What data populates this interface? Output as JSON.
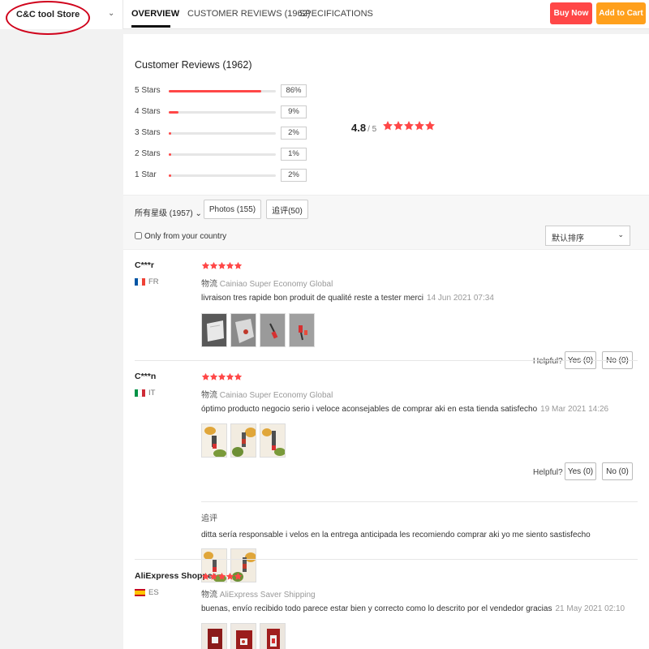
{
  "store": {
    "name": "C&C tool Store"
  },
  "tabs": [
    {
      "label": "OVERVIEW"
    },
    {
      "label": "CUSTOMER REVIEWS (1962)"
    },
    {
      "label": "SPECIFICATIONS"
    }
  ],
  "actions": {
    "buy_now": "Buy Now",
    "add_to_cart": "Add to Cart"
  },
  "colors": {
    "accent": "#ff4747",
    "cart": "#ffa01c",
    "star": "#ff4747"
  },
  "summary": {
    "title": "Customer Reviews (1962)",
    "average": "4.8",
    "out_of": "/ 5",
    "average_value": 4.8,
    "distribution": [
      {
        "label": "5 Stars",
        "pct": "86%",
        "value": 86
      },
      {
        "label": "4 Stars",
        "pct": "9%",
        "value": 9
      },
      {
        "label": "3 Stars",
        "pct": "2%",
        "value": 2
      },
      {
        "label": "2 Stars",
        "pct": "1%",
        "value": 1
      },
      {
        "label": "1 Star",
        "pct": "2%",
        "value": 2
      }
    ]
  },
  "filters": {
    "all_ratings": "所有星级 (1957)",
    "photos": "Photos (155)",
    "additional": "追评(50)",
    "only_country": "Only from your country",
    "sort": "默认排序"
  },
  "helpful": {
    "label": "Helpful?",
    "yes": "Yes (0)",
    "no": "No (0)"
  },
  "reviews": [
    {
      "user": "C***r",
      "country": "FR",
      "rating": 5,
      "shipping_prefix": "物流",
      "shipping": "Cainiao Super Economy Global",
      "text": "livraison tres rapide bon produit de qualité reste a tester merci",
      "date": "14 Jun 2021 07:34"
    },
    {
      "user": "C***n",
      "country": "IT",
      "rating": 5,
      "shipping_prefix": "物流",
      "shipping": "Cainiao Super Economy Global",
      "text": "óptimo producto negocio serio i veloce aconsejables de comprar aki en esta tienda satisfecho",
      "date": "19 Mar 2021 14:26",
      "additional_label": "追评",
      "additional_text": "ditta sería responsable i velos en la entrega anticipada les recomiendo comprar aki yo me siento sastisfecho"
    },
    {
      "user": "AliExpress Shopper",
      "country": "ES",
      "rating": 5,
      "shipping_prefix": "物流",
      "shipping": "AliExpress Saver Shipping",
      "text": "buenas, envío recibido todo parece estar bien y correcto como lo descrito por el vendedor gracias",
      "date": "21 May 2021 02:10"
    }
  ]
}
